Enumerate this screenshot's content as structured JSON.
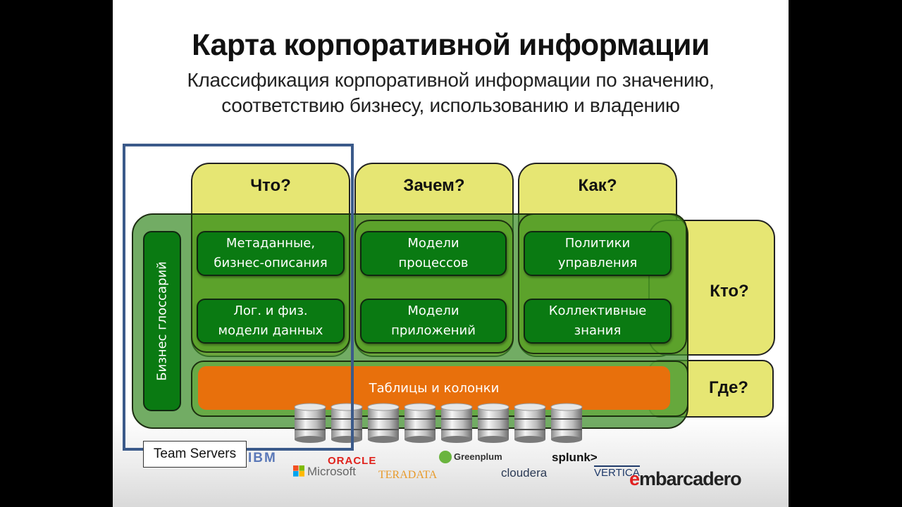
{
  "title": "Карта корпоративной информации",
  "subtitle_line1": "Классификация корпоративной информации по значению,",
  "subtitle_line2": "соответствию бизнесу, использованию и владению",
  "questions": {
    "what": "Что?",
    "why": "Зачем?",
    "how": "Как?",
    "who": "Кто?",
    "where": "Где?"
  },
  "glossary": "Бизнес глоссарий",
  "boxes": {
    "metadata": [
      "Метаданные,",
      "бизнес-описания"
    ],
    "data_models": [
      "Лог. и физ.",
      "модели данных"
    ],
    "process_models": [
      "Модели",
      "процессов"
    ],
    "app_models": [
      "Модели",
      "приложений"
    ],
    "policies": [
      "Политики",
      "управления"
    ],
    "knowledge": [
      "Коллективные",
      "знания"
    ]
  },
  "tables": "Таблицы и колонки",
  "team_servers": "Team Servers",
  "database_count": 8,
  "logos": {
    "ibm": "IBM",
    "microsoft": "Microsoft",
    "oracle": "ORACLE",
    "teradata": "TERADATA",
    "greenplum": "Greenplum",
    "cloudera": "cloudera",
    "splunk": "splunk>",
    "vertica": "VERTICA",
    "embarcadero": "mbarcadero",
    "embarcadero_e": "e"
  },
  "colors": {
    "question_yellow": "#e6e673",
    "box_green": "#0a7a12",
    "tables_orange": "#e8700c",
    "team_frame_blue": "#3b5a8a"
  }
}
